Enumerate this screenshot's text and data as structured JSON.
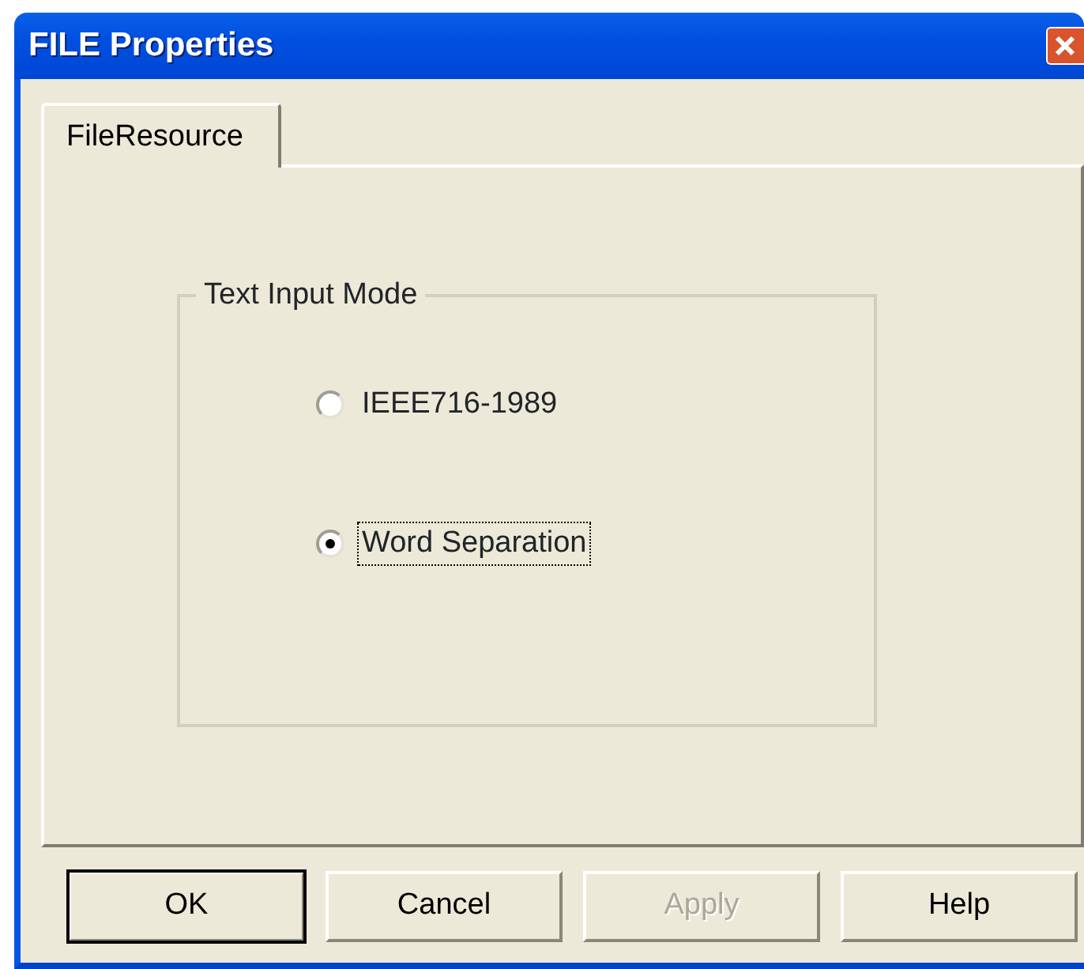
{
  "window": {
    "title": "FILE Properties"
  },
  "tabs": [
    {
      "label": "FileResource",
      "selected": true
    }
  ],
  "group": {
    "title": "Text Input Mode",
    "options": [
      {
        "label": "IEEE716-1989",
        "selected": false,
        "focused": false
      },
      {
        "label": "Word Separation",
        "selected": true,
        "focused": true
      }
    ]
  },
  "buttons": [
    {
      "label": "OK",
      "default": true,
      "disabled": false
    },
    {
      "label": "Cancel",
      "default": false,
      "disabled": false
    },
    {
      "label": "Apply",
      "default": false,
      "disabled": true
    },
    {
      "label": "Help",
      "default": false,
      "disabled": false
    }
  ]
}
